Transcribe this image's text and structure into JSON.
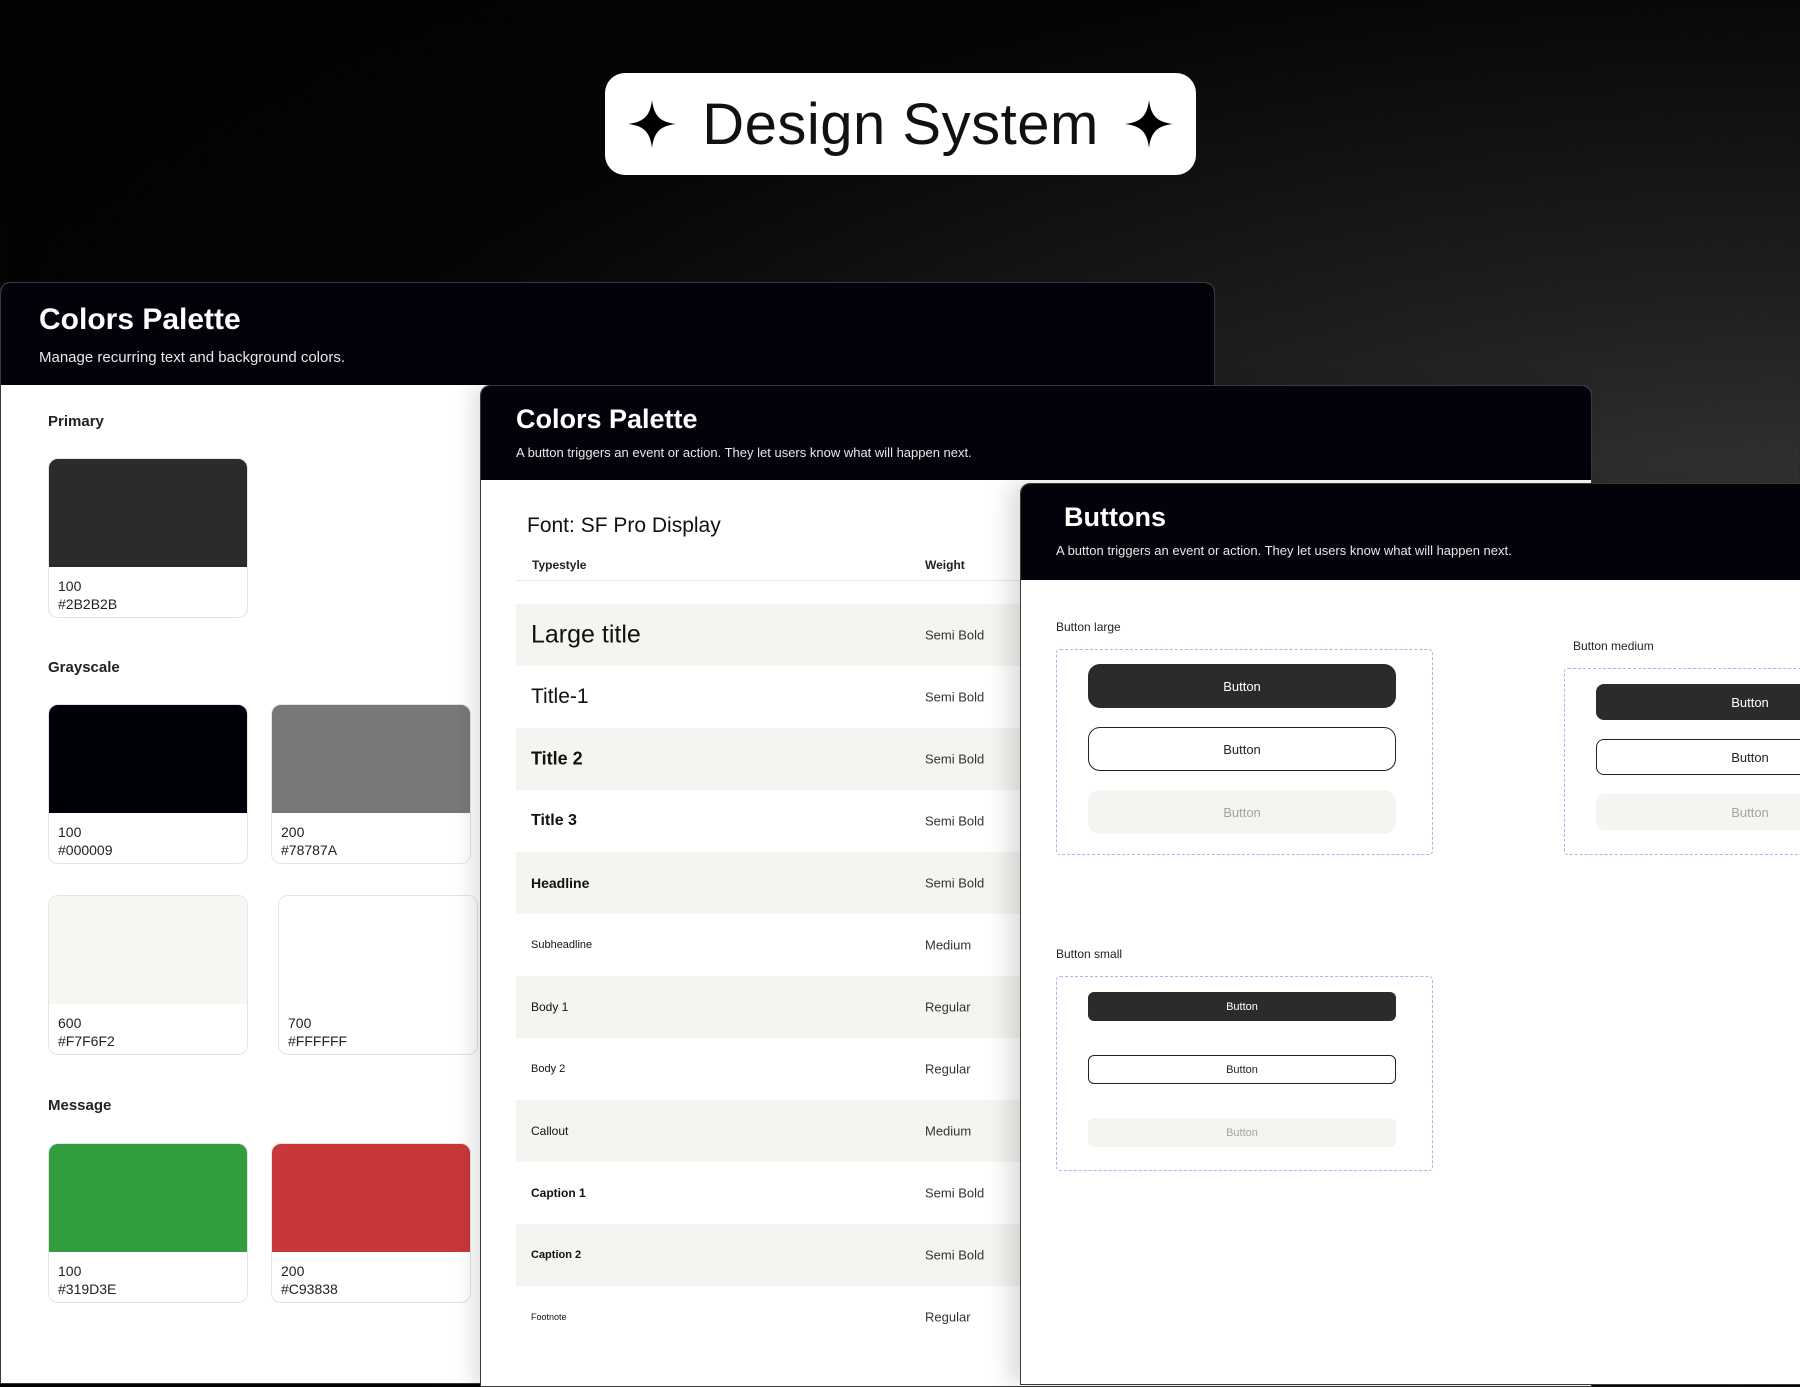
{
  "header": {
    "title": "Design System"
  },
  "colors_panel": {
    "title": "Colors Palette",
    "subtitle": "Manage recurring text and background colors.",
    "primary": {
      "label": "Primary",
      "swatches": [
        {
          "name": "100",
          "hex": "#2B2B2B",
          "color": "#2B2B2B"
        }
      ]
    },
    "grayscale": {
      "label": "Grayscale",
      "swatches": [
        {
          "name": "100",
          "hex": "#000009",
          "color": "#000009"
        },
        {
          "name": "200",
          "hex": "#78787A",
          "color": "#78787A"
        },
        {
          "name": "600",
          "hex": "#F7F6F2",
          "color": "#F7F6F2"
        },
        {
          "name": "700",
          "hex": "#FFFFFF",
          "color": "#FFFFFF"
        }
      ]
    },
    "message": {
      "label": "Message",
      "swatches": [
        {
          "name": "100",
          "hex": "#319D3E",
          "color": "#319D3E"
        },
        {
          "name": "200",
          "hex": "#C93838",
          "color": "#C93838"
        }
      ]
    }
  },
  "typography_panel": {
    "title": "Colors Palette",
    "subtitle": "A button triggers an event or action. They let users know what will happen next.",
    "font_title": "Font: SF Pro Display",
    "columns": {
      "typestyle": "Typestyle",
      "weight": "Weight"
    },
    "rows": [
      {
        "name": "Large title",
        "weight": "Semi Bold"
      },
      {
        "name": "Title-1",
        "weight": "Semi Bold"
      },
      {
        "name": "Title 2",
        "weight": "Semi Bold"
      },
      {
        "name": "Title 3",
        "weight": "Semi Bold"
      },
      {
        "name": "Headline",
        "weight": "Semi Bold"
      },
      {
        "name": "Subheadline",
        "weight": "Medium"
      },
      {
        "name": "Body 1",
        "weight": "Regular"
      },
      {
        "name": "Body 2",
        "weight": "Regular"
      },
      {
        "name": "Callout",
        "weight": "Medium"
      },
      {
        "name": "Caption 1",
        "weight": "Semi Bold"
      },
      {
        "name": "Caption 2",
        "weight": "Semi Bold"
      },
      {
        "name": "Footnote",
        "weight": "Regular"
      }
    ]
  },
  "buttons_panel": {
    "title": "Buttons",
    "subtitle": "A button triggers an event or action. They let users know what will happen next.",
    "large": {
      "label": "Button large",
      "buttons": [
        "Button",
        "Button",
        "Button"
      ]
    },
    "medium": {
      "label": "Button medium",
      "buttons": [
        "Button",
        "Button",
        "Button"
      ]
    },
    "small": {
      "label": "Button small",
      "buttons": [
        "Button",
        "Button",
        "Button"
      ]
    }
  },
  "theme": {
    "dark": "#03020A",
    "primary": "#2B2B2B",
    "disabled_bg": "#F5F4F0",
    "dash": "#B7AEEC"
  }
}
